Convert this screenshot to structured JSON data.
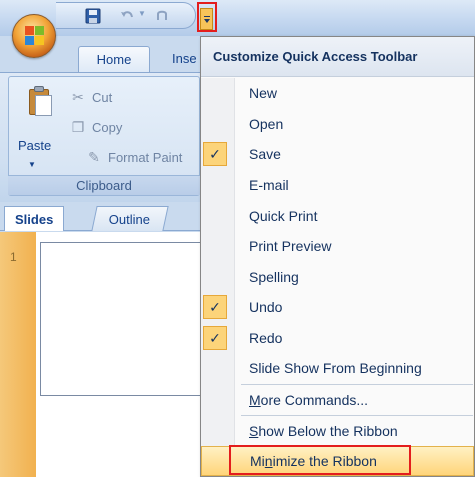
{
  "window": {
    "tabs": [
      "Home",
      "Inse"
    ],
    "clipboard": {
      "paste_label": "Paste",
      "cut_label": "Cut",
      "copy_label": "Copy",
      "format_label": "Format Paint",
      "group_label": "Clipboard"
    },
    "pane_tabs": [
      "Slides",
      "Outline"
    ],
    "slide_number": "1"
  },
  "qat_menu": {
    "header": "Customize Quick Access Toolbar",
    "items": [
      {
        "label": "New",
        "checked": false
      },
      {
        "label": "Open",
        "checked": false
      },
      {
        "label": "Save",
        "checked": true
      },
      {
        "label": "E-mail",
        "checked": false
      },
      {
        "label": "Quick Print",
        "checked": false
      },
      {
        "label": "Print Preview",
        "checked": false
      },
      {
        "label": "Spelling",
        "checked": false
      },
      {
        "label": "Undo",
        "checked": true
      },
      {
        "label": "Redo",
        "checked": true
      },
      {
        "label": "Slide Show From Beginning",
        "checked": false
      }
    ],
    "more_commands": {
      "accel": "M",
      "rest": "ore Commands..."
    },
    "show_below": {
      "accel": "S",
      "rest": "how Below the Ribbon"
    },
    "minimize": {
      "pre": "Mi",
      "accel": "n",
      "rest": "imize the Ribbon"
    }
  },
  "icons": {
    "check": "checkmark-icon",
    "office": "office-button-icon",
    "save": "save-icon",
    "undo": "undo-icon",
    "redo": "redo-icon"
  },
  "colors": {
    "highlight_border": "#e31d1d",
    "check_background": "#fcd47a",
    "hover_background": "#ffd57a"
  }
}
